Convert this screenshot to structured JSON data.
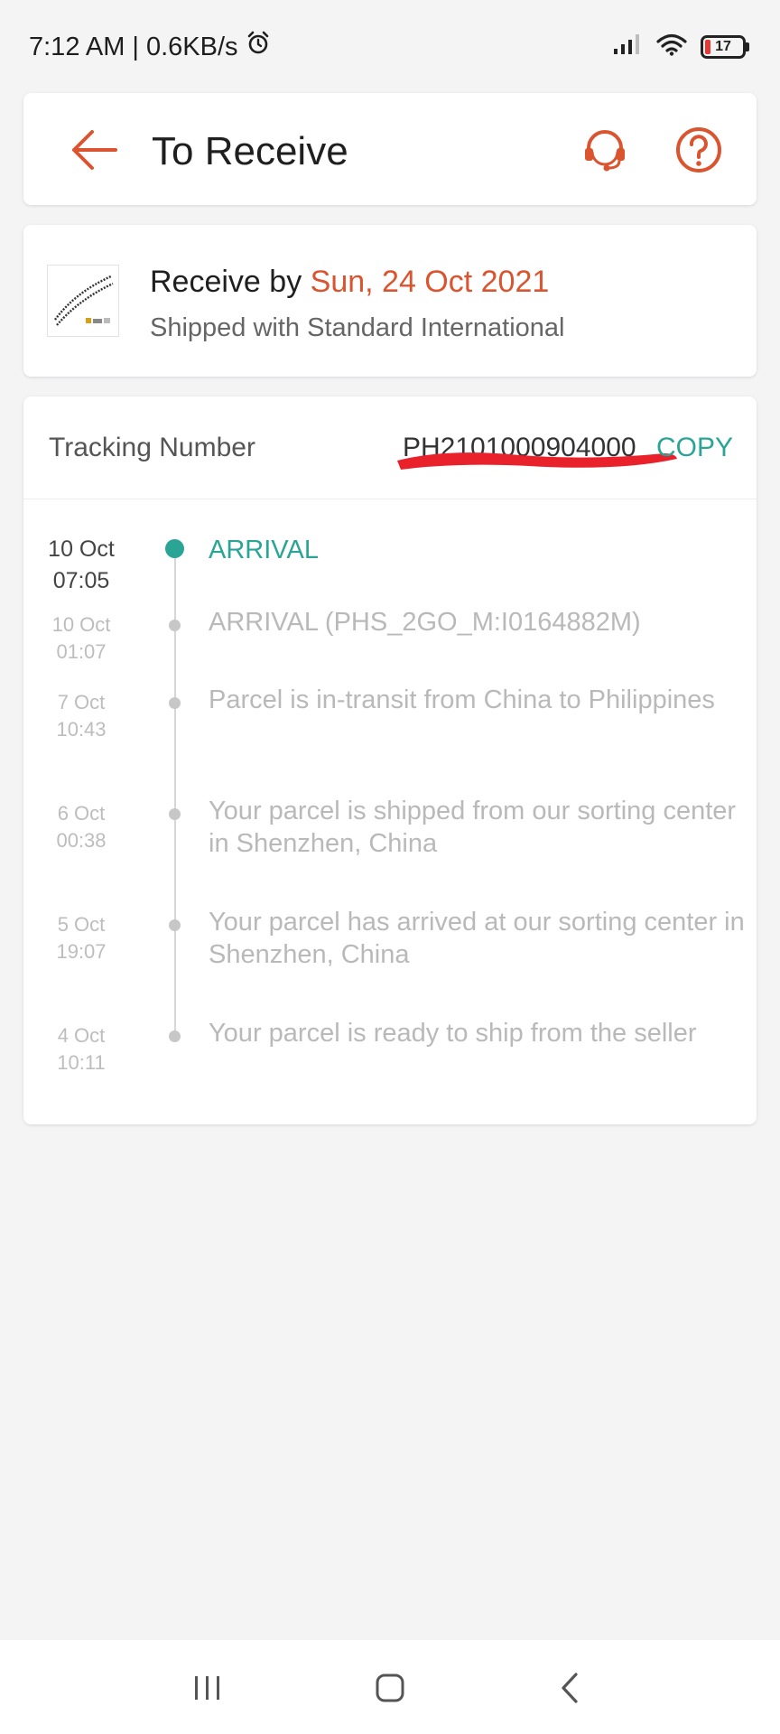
{
  "status_bar": {
    "time": "7:12 AM",
    "separator": "|",
    "speed": "0.6KB/s",
    "battery": "17",
    "icons": [
      "alarm-icon",
      "signal-icon",
      "wifi-icon",
      "battery-icon"
    ]
  },
  "header": {
    "title": "To Receive",
    "back_icon": "arrow-left-icon",
    "support_icon": "headset-icon",
    "help_icon": "question-icon"
  },
  "delivery": {
    "receive_prefix": "Receive by",
    "receive_date": "Sun, 24 Oct 2021",
    "shipped_text": "Shipped with Standard International"
  },
  "tracking": {
    "label": "Tracking Number",
    "number": "PH2101000904000",
    "copy_label": "COPY",
    "events": [
      {
        "date": "10 Oct",
        "time": "07:05",
        "desc": "ARRIVAL",
        "active": true
      },
      {
        "date": "10 Oct",
        "time": "01:07",
        "desc": "ARRIVAL (PHS_2GO_M:I0164882M)",
        "active": false
      },
      {
        "date": "7 Oct",
        "time": "10:43",
        "desc": "Parcel is in-transit from China to Philippines",
        "active": false
      },
      {
        "date": "6 Oct",
        "time": "00:38",
        "desc": "Your parcel is shipped from our sorting center in Shenzhen, China",
        "active": false
      },
      {
        "date": "5 Oct",
        "time": "19:07",
        "desc": "Your parcel has arrived at our sorting center in Shenzhen, China",
        "active": false
      },
      {
        "date": "4 Oct",
        "time": "10:11",
        "desc": "Your parcel is ready to ship from the seller",
        "active": false
      }
    ]
  },
  "colors": {
    "accent_orange": "#d9542f",
    "accent_teal": "#2aa595",
    "redaction_red": "#e8212a"
  },
  "nav": {
    "icons": [
      "recents-icon",
      "home-icon",
      "back-icon"
    ]
  }
}
